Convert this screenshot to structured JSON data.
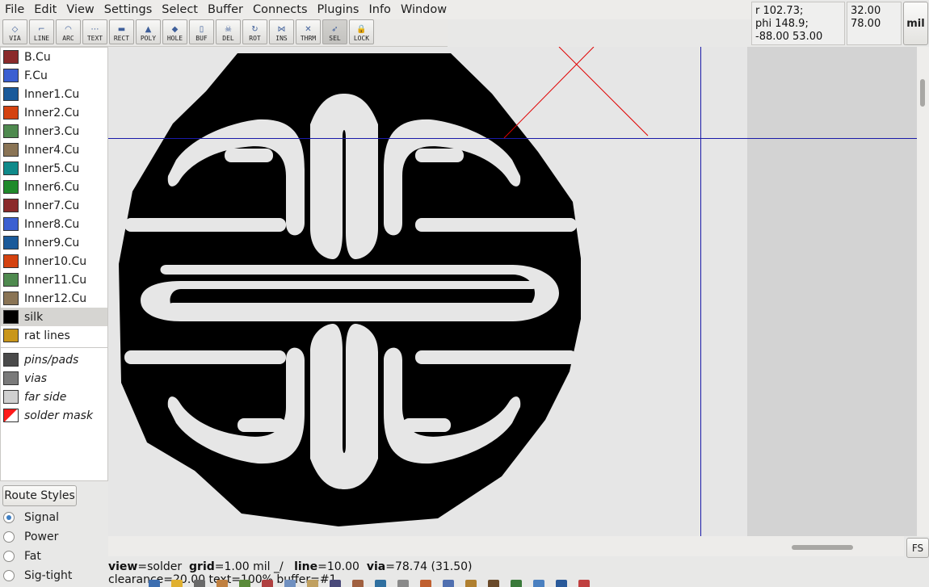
{
  "menu": [
    "File",
    "Edit",
    "View",
    "Settings",
    "Select",
    "Buffer",
    "Connects",
    "Plugins",
    "Info",
    "Window"
  ],
  "tools": [
    {
      "label": "VIA",
      "icon": "via-icon",
      "glyph": "◇"
    },
    {
      "label": "LINE",
      "icon": "line-icon",
      "glyph": "⌐"
    },
    {
      "label": "ARC",
      "icon": "arc-icon",
      "glyph": "◠"
    },
    {
      "label": "TEXT",
      "icon": "text-icon",
      "glyph": "⋯"
    },
    {
      "label": "RECT",
      "icon": "rect-icon",
      "glyph": "▬"
    },
    {
      "label": "POLY",
      "icon": "poly-icon",
      "glyph": "▲"
    },
    {
      "label": "HOLE",
      "icon": "hole-icon",
      "glyph": "◆"
    },
    {
      "label": "BUF",
      "icon": "buffer-icon",
      "glyph": "▯"
    },
    {
      "label": "DEL",
      "icon": "delete-icon",
      "glyph": "☠"
    },
    {
      "label": "ROT",
      "icon": "rotate-icon",
      "glyph": "↻"
    },
    {
      "label": "INS",
      "icon": "insert-icon",
      "glyph": "⋈"
    },
    {
      "label": "THRM",
      "icon": "thermal-icon",
      "glyph": "✕"
    },
    {
      "label": "SEL",
      "icon": "select-icon",
      "glyph": "➶"
    },
    {
      "label": "LOCK",
      "icon": "lock-icon",
      "glyph": "🔒"
    }
  ],
  "active_tool": "SEL",
  "readout": {
    "line1": "r 102.73;",
    "line2": "phi 148.9;",
    "line3": "-88.00 53.00",
    "x": "32.00",
    "y": "78.00",
    "units": "mil"
  },
  "layers": [
    {
      "name": "B.Cu",
      "color": "#8b2a2a",
      "italic": false,
      "selected": false
    },
    {
      "name": "F.Cu",
      "color": "#3b5fd1",
      "italic": false,
      "selected": false
    },
    {
      "name": "Inner1.Cu",
      "color": "#1a5a9a",
      "italic": false,
      "selected": false
    },
    {
      "name": "Inner2.Cu",
      "color": "#d4420f",
      "italic": false,
      "selected": false
    },
    {
      "name": "Inner3.Cu",
      "color": "#4f8a4f",
      "italic": false,
      "selected": false
    },
    {
      "name": "Inner4.Cu",
      "color": "#8a7455",
      "italic": false,
      "selected": false
    },
    {
      "name": "Inner5.Cu",
      "color": "#0f8a8a",
      "italic": false,
      "selected": false
    },
    {
      "name": "Inner6.Cu",
      "color": "#1f8a2a",
      "italic": false,
      "selected": false
    },
    {
      "name": "Inner7.Cu",
      "color": "#8b2a2a",
      "italic": false,
      "selected": false
    },
    {
      "name": "Inner8.Cu",
      "color": "#3b5fd1",
      "italic": false,
      "selected": false
    },
    {
      "name": "Inner9.Cu",
      "color": "#1a5a9a",
      "italic": false,
      "selected": false
    },
    {
      "name": "Inner10.Cu",
      "color": "#d4420f",
      "italic": false,
      "selected": false
    },
    {
      "name": "Inner11.Cu",
      "color": "#4f8a4f",
      "italic": false,
      "selected": false
    },
    {
      "name": "Inner12.Cu",
      "color": "#8a7455",
      "italic": false,
      "selected": false
    },
    {
      "name": "silk",
      "color": "#000000",
      "italic": false,
      "selected": true
    },
    {
      "name": "rat lines",
      "color": "#c9961a",
      "italic": false,
      "selected": false
    }
  ],
  "special_layers": [
    {
      "name": "pins/pads",
      "color": "#4a4a4a",
      "italic": true
    },
    {
      "name": "vias",
      "color": "#7a7a7a",
      "italic": true
    },
    {
      "name": "far side",
      "color": "#d0d0d0",
      "italic": true
    },
    {
      "name": "solder mask",
      "color": "mask",
      "italic": true
    }
  ],
  "route_styles": {
    "button": "Route Styles",
    "options": [
      {
        "name": "Signal",
        "checked": true
      },
      {
        "name": "Power",
        "checked": false
      },
      {
        "name": "Fat",
        "checked": false
      },
      {
        "name": "Sig-tight",
        "checked": false
      }
    ]
  },
  "fs_label": "FS",
  "status": {
    "view_key": "view",
    "view_val": "=solder",
    "grid_key": "grid",
    "grid_val": "=1.00 mil  _/",
    "line_key": "line",
    "line_val": "=10.00",
    "via_key": "via",
    "via_val": "=78.74 (31.50)",
    "line2": "clearance=20.00  text=100%  buffer=#1"
  },
  "colors": {
    "canvas_bg": "#e6e6e6",
    "silk": "#000000",
    "crosshair": "#1a1aa8",
    "cursor_mark": "#e00000"
  }
}
